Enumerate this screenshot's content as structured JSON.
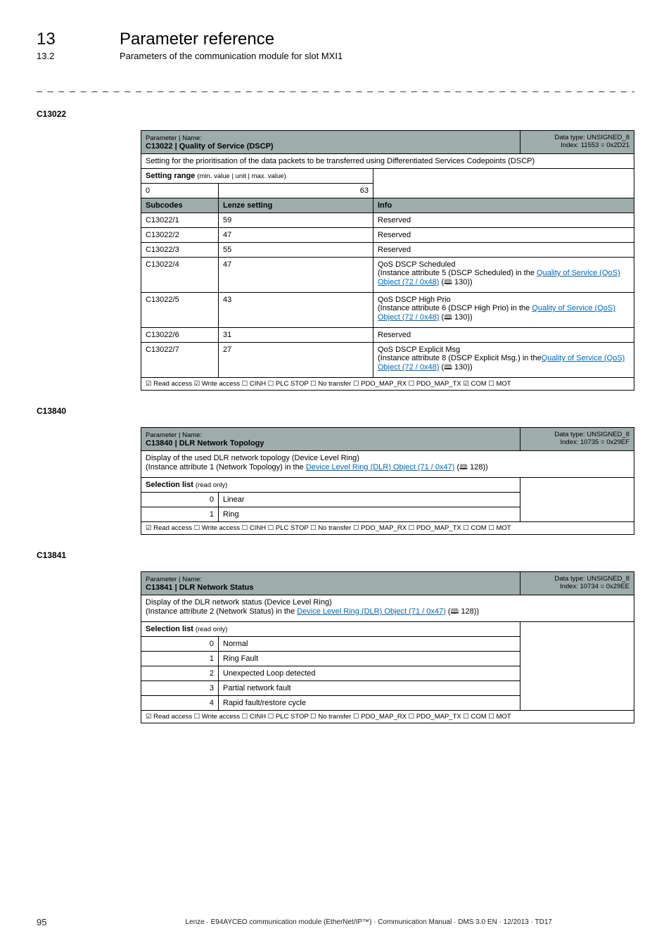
{
  "header": {
    "chapter_num": "13",
    "chapter_title": "Parameter reference",
    "section_num": "13.2",
    "section_title": "Parameters of the communication module for slot MXI1"
  },
  "dashline": "_ _ _ _ _ _ _ _ _ _ _ _ _ _ _ _ _ _ _ _ _ _ _ _ _ _ _ _ _ _ _ _ _ _ _ _ _ _ _ _ _ _ _ _ _ _ _ _ _ _ _ _ _ _ _ _ _ _ _ _ _ _ _ _",
  "labels": {
    "param_name": "Parameter | Name:",
    "setting_range": "Setting range",
    "setting_range_detail": "(min. value | unit | max. value)",
    "subcodes": "Subcodes",
    "lenze_setting": "Lenze setting",
    "info": "Info",
    "selection_list": "Selection list",
    "read_only": "(read only)",
    "reserved": "Reserved"
  },
  "c13022": {
    "code": "C13022",
    "name": "C13022 | Quality of Service (DSCP)",
    "dtype": "Data type: UNSIGNED_8",
    "index": "Index: 11553 = 0x2D21",
    "desc": "Setting for the prioritisation of the data packets to be transferred using Differentiated Services Codepoints (DSCP)",
    "range_min": "0",
    "range_max": "63",
    "rows": [
      {
        "sub": "C13022/1",
        "set": "59",
        "info_plain": "Reserved"
      },
      {
        "sub": "C13022/2",
        "set": "47",
        "info_plain": "Reserved"
      },
      {
        "sub": "C13022/3",
        "set": "55",
        "info_plain": "Reserved"
      },
      {
        "sub": "C13022/4",
        "set": "47",
        "i1": "QoS DSCP Scheduled",
        "i2a": "(Instance attribute 5 (DSCP Scheduled) in the ",
        "link": "Quality of Service (QoS) Object (72 / 0x48)",
        "pageref": "130"
      },
      {
        "sub": "C13022/5",
        "set": "43",
        "i1": "QoS DSCP High Prio",
        "i2a": "(Instance attribute 6 (DSCP High Prio) in the ",
        "link": "Quality of Service (QoS) Object (72 / 0x48)",
        "pageref": "130"
      },
      {
        "sub": "C13022/6",
        "set": "31",
        "info_plain": "Reserved"
      },
      {
        "sub": "C13022/7",
        "set": "27",
        "i1": "QoS DSCP Explicit Msg",
        "i2a": "(Instance attribute 8 (DSCP Explicit Msg.) in the",
        "link": "Quality of Service (QoS) Object (72 / 0x48)",
        "pageref": "130"
      }
    ],
    "access": "☑ Read access  ☑ Write access  ☐ CINH  ☐ PLC STOP  ☐ No transfer  ☐ PDO_MAP_RX  ☐ PDO_MAP_TX  ☑ COM  ☐ MOT"
  },
  "c13840": {
    "code": "C13840",
    "name": "C13840 | DLR Network Topology",
    "dtype": "Data type: UNSIGNED_8",
    "index": "Index: 10735 = 0x29EF",
    "desc_pre": "Display of the used DLR network topology (Device Level Ring)",
    "desc_a": "(Instance attribute 1 (Network Topology) in the ",
    "desc_link": "Device Level Ring (DLR) Object (71 / 0x47)",
    "desc_pageref": "128",
    "options": [
      {
        "k": "0",
        "v": "Linear"
      },
      {
        "k": "1",
        "v": "Ring"
      }
    ],
    "access": "☑ Read access  ☐ Write access  ☐ CINH  ☐ PLC STOP  ☐ No transfer  ☐ PDO_MAP_RX  ☐ PDO_MAP_TX  ☐ COM  ☐ MOT"
  },
  "c13841": {
    "code": "C13841",
    "name": "C13841 | DLR Network Status",
    "dtype": "Data type: UNSIGNED_8",
    "index": "Index: 10734 = 0x29EE",
    "desc_pre": "Display of the DLR network status (Device Level Ring)",
    "desc_a": "(Instance attribute 2 (Network Status) in the ",
    "desc_link": "Device Level Ring (DLR) Object (71 / 0x47)",
    "desc_pageref": "128",
    "options": [
      {
        "k": "0",
        "v": "Normal"
      },
      {
        "k": "1",
        "v": "Ring Fault"
      },
      {
        "k": "2",
        "v": "Unexpected Loop detected"
      },
      {
        "k": "3",
        "v": "Partial network fault"
      },
      {
        "k": "4",
        "v": "Rapid fault/restore cycle"
      }
    ],
    "access": "☑ Read access  ☐ Write access  ☐ CINH  ☐ PLC STOP  ☐ No transfer  ☐ PDO_MAP_RX  ☐ PDO_MAP_TX  ☐ COM  ☐ MOT"
  },
  "footer": {
    "page": "95",
    "text": "Lenze · E94AYCEO communication module (EtherNet/IP™) · Communication Manual · DMS 3.0 EN · 12/2013 · TD17"
  },
  "sym": {
    "book": "🕮",
    "close_paren": "))"
  }
}
